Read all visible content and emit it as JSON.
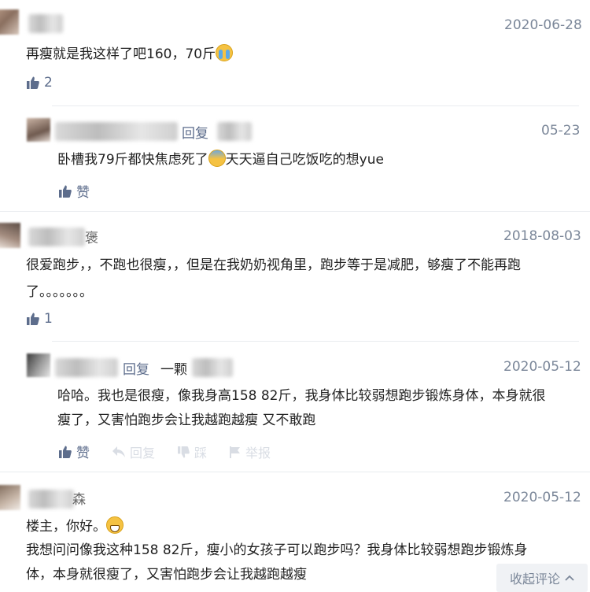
{
  "comments": [
    {
      "date": "2020-06-28",
      "text_line1": "再瘦就是我这样了吧160，70斤",
      "likes": "2"
    },
    {
      "reply_label": "回复",
      "date": "05-23",
      "text_before": "卧槽我79斤都快焦虑死了",
      "text_after": "天天逼自己吃饭吃的想yue",
      "like_label": "赞"
    },
    {
      "name_partial": "褒",
      "date": "2018-08-03",
      "text_line1": "很爱跑步，，不跑也很瘦，，但是在我奶奶视角里，跑步等于是减肥，够瘦了不能再跑",
      "text_line2": "了。。。。。。。",
      "likes": "1"
    },
    {
      "reply_label": "回复",
      "reply_target": "一颗",
      "date": "2020-05-12",
      "text_line1": "哈哈。我也是很瘦，像我身高158 82斤，我身体比较弱想跑步锻炼身体，本身就很",
      "text_line2": "瘦了，又害怕跑步会让我越跑越瘦 又不敢跑",
      "like_label": "赞",
      "action_reply": "回复",
      "action_report": "举报",
      "action_dislike": "踩"
    },
    {
      "name_partial": "森",
      "date": "2020-05-12",
      "text_line1": "楼主，你好。",
      "text_line2": "我想问问像我这种158 82斤，瘦小的女孩子可以跑步吗？我身体比较弱想跑步锻炼身",
      "text_line3": "体，本身就很瘦了，又害怕跑步会让我越跑越瘦"
    }
  ],
  "collapse_label": "收起评论",
  "icons": {
    "like": "thumbs-up-icon",
    "reply": "reply-arrow-icon",
    "report": "flag-icon",
    "dislike": "thumbs-down-icon",
    "collapse": "chevron-up-icon"
  },
  "colors": {
    "link": "#5d6d8c",
    "date": "#7b8799",
    "text": "#222222"
  }
}
